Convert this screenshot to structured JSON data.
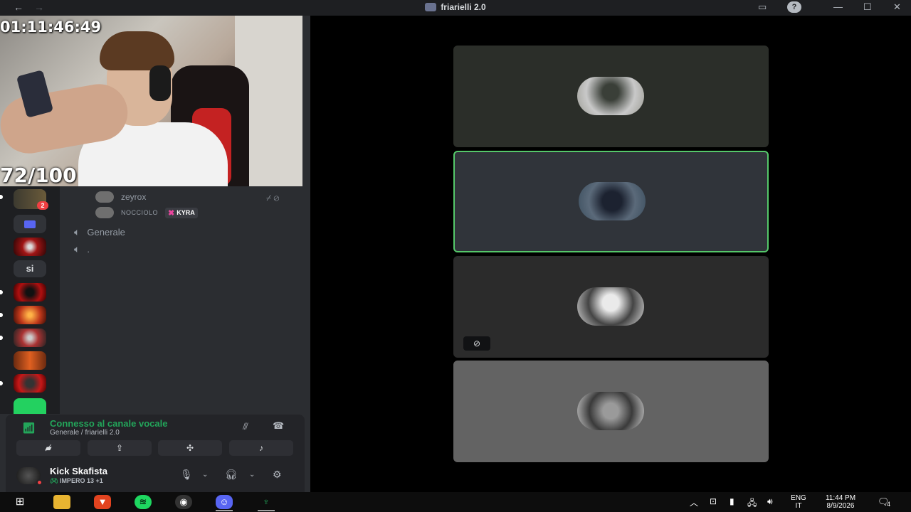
{
  "window": {
    "title": "friarielli 2.0"
  },
  "stream_overlay": {
    "timer": "01:11:46:49",
    "score": "72/100"
  },
  "server_rail": {
    "badge_count": "2",
    "text_server": "si"
  },
  "voice_users": [
    {
      "name": "zeyrox"
    },
    {
      "name": "NOCCIOLO",
      "tag": "KYRA"
    }
  ],
  "channels": [
    {
      "name": "Generale"
    },
    {
      "name": "."
    }
  ],
  "voice_panel": {
    "status": "Connesso al canale vocale",
    "location": "Generale / friarielli 2.0"
  },
  "user_bar": {
    "username": "Kick Skafista",
    "activity": "IMPERO 13 +1"
  },
  "taskbar": {
    "language": "ENG",
    "layout": "IT",
    "time": "11:44 PM",
    "date": "8/9/2026",
    "notifications": "4"
  },
  "colors": {
    "accent_green": "#23a55a",
    "speaking_border": "#55c86a",
    "badge_red": "#f23f43"
  }
}
